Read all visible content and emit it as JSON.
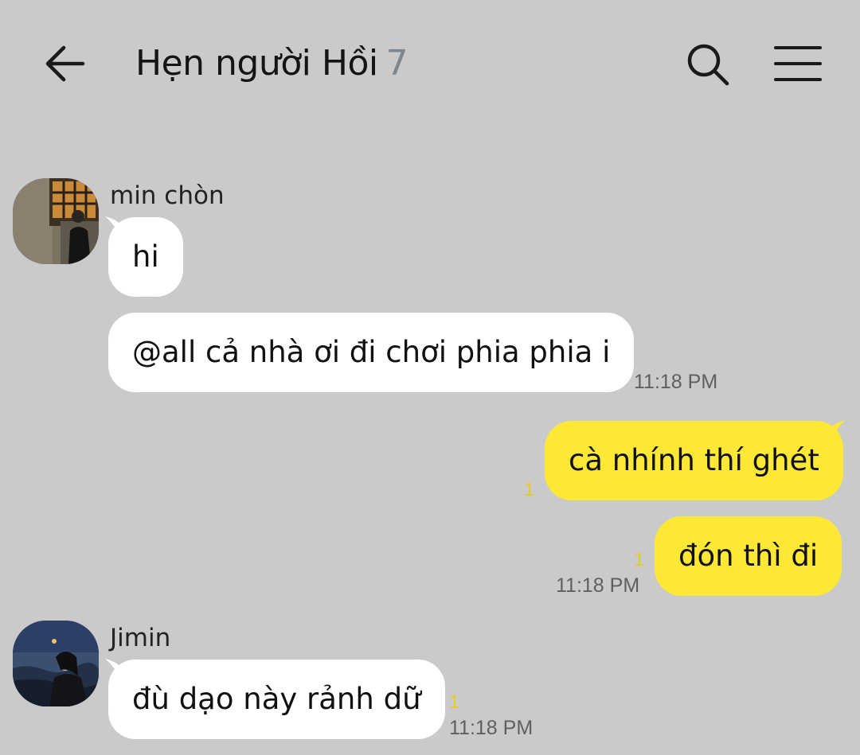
{
  "header": {
    "back_icon": "arrow-left-icon",
    "title": "Hẹn người Hồi",
    "member_count": "7",
    "search_icon": "search-icon",
    "menu_icon": "hamburger-menu-icon"
  },
  "colors": {
    "background": "#cacaca",
    "incoming_bubble": "#ffffff",
    "outgoing_bubble": "#fee836",
    "unread_count": "#e1cc28",
    "member_count": "#7d868d",
    "timestamp": "#5f5f5f"
  },
  "messages": [
    {
      "sender": "min chòn",
      "direction": "incoming",
      "text": "hi"
    },
    {
      "direction": "incoming",
      "text": "@all cả nhà ơi đi chơi phia phia i",
      "time": "11:18 PM"
    },
    {
      "direction": "outgoing",
      "text": "cà nhính thí ghét",
      "unread": "1"
    },
    {
      "direction": "outgoing",
      "text": "đón thì đi",
      "unread": "1",
      "time": "11:18 PM"
    },
    {
      "sender": "Jimin",
      "direction": "incoming",
      "text": "đù dạo này rảnh dữ",
      "unread": "1",
      "time": "11:18 PM"
    }
  ]
}
